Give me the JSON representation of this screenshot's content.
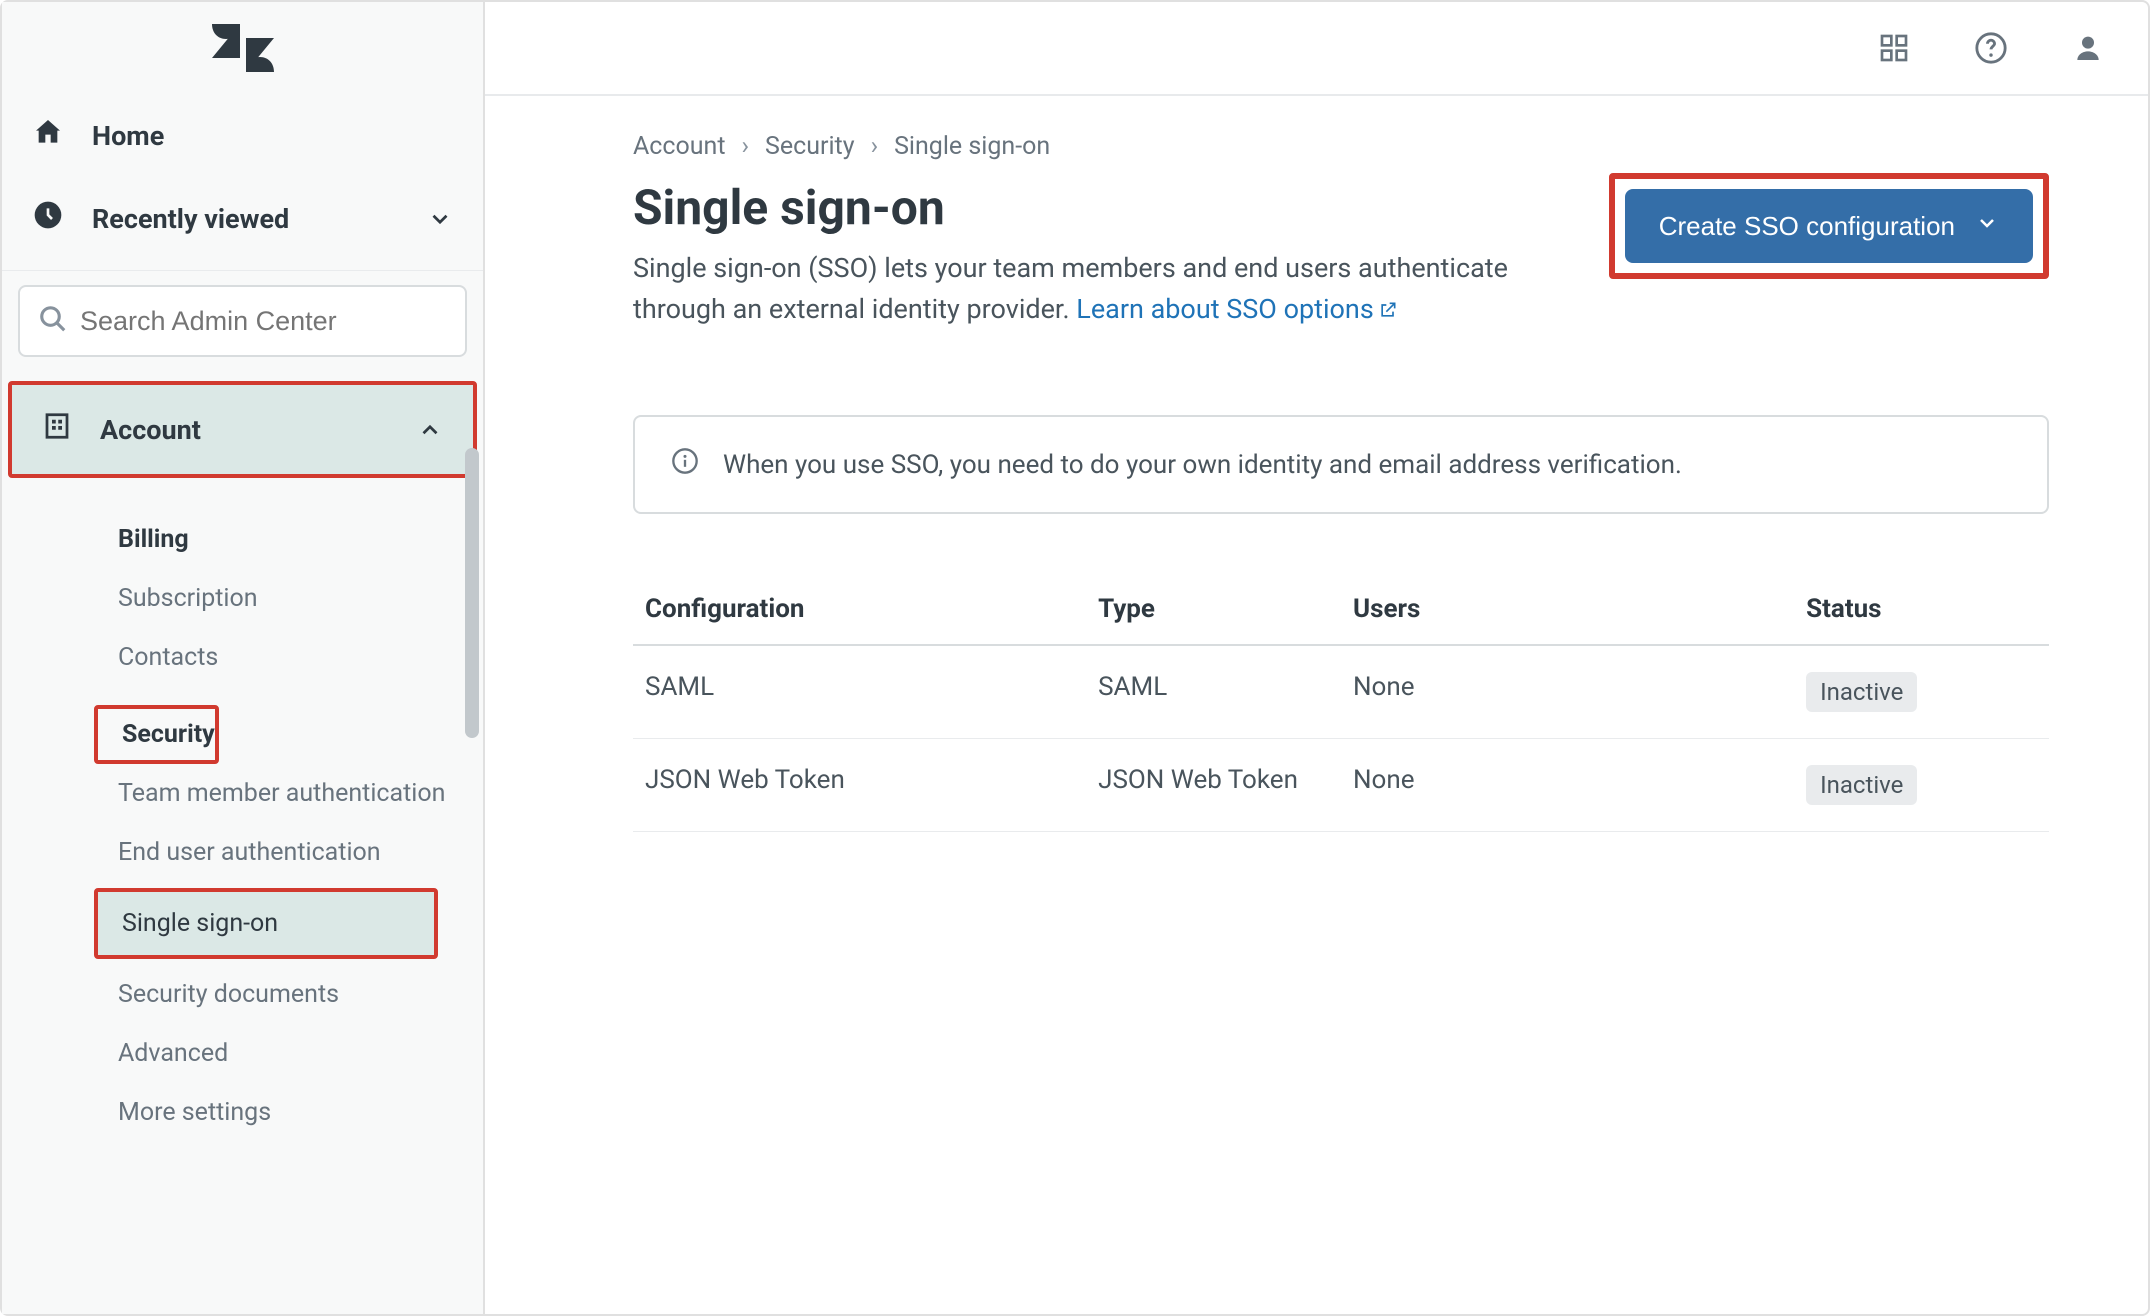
{
  "sidebar": {
    "nav": {
      "home": "Home",
      "recently": "Recently viewed"
    },
    "search_placeholder": "Search Admin Center",
    "section_label": "Account",
    "items": {
      "billing": "Billing",
      "subscription": "Subscription",
      "contacts": "Contacts",
      "security": "Security",
      "team_auth": "Team member authentication",
      "end_user_auth": "End user authentication",
      "sso": "Single sign-on",
      "sec_docs": "Security documents",
      "advanced": "Advanced",
      "more": "More settings"
    }
  },
  "breadcrumb": {
    "a": "Account",
    "b": "Security",
    "c": "Single sign-on"
  },
  "page": {
    "title": "Single sign-on",
    "desc_prefix": "Single sign-on (SSO) lets your team members and end users authenticate through an external identity provider. ",
    "desc_link": "Learn about SSO options",
    "cta": "Create SSO configuration",
    "banner": "When you use SSO, you need to do your own identity and email address verification."
  },
  "table": {
    "headers": {
      "config": "Configuration",
      "type": "Type",
      "users": "Users",
      "status": "Status"
    },
    "rows": [
      {
        "config": "SAML",
        "type": "SAML",
        "users": "None",
        "status": "Inactive"
      },
      {
        "config": "JSON Web Token",
        "type": "JSON Web Token",
        "users": "None",
        "status": "Inactive"
      }
    ]
  }
}
